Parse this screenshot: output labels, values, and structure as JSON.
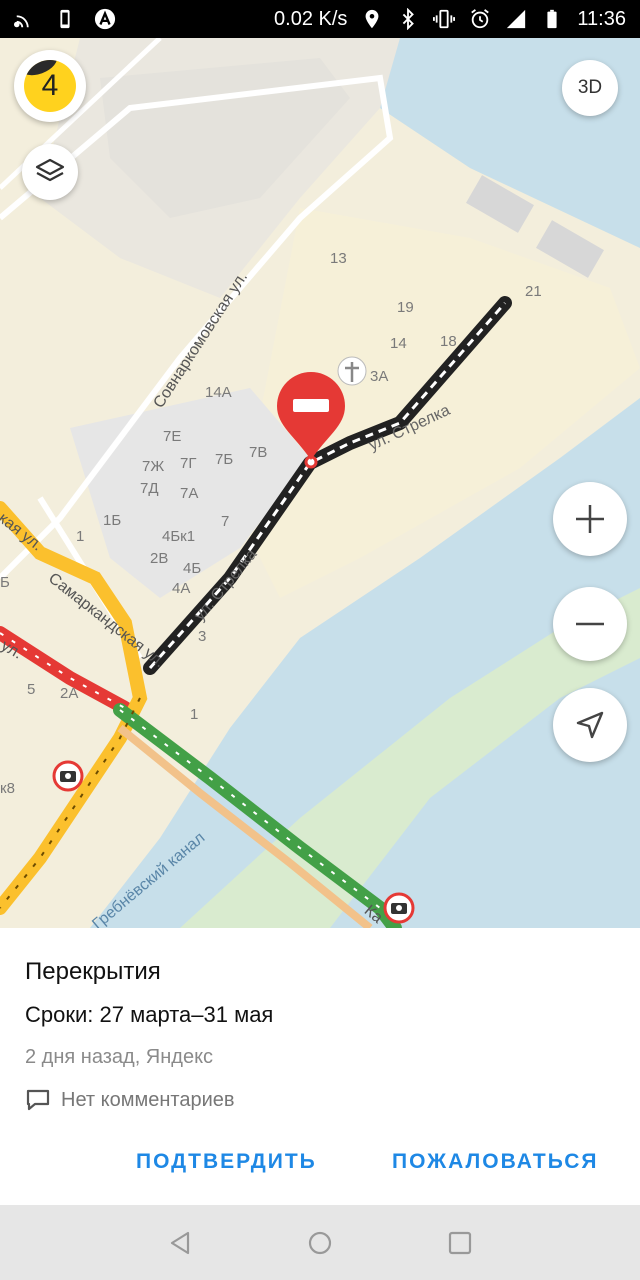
{
  "status_bar": {
    "network_speed": "0.02 K/s",
    "time": "11:36",
    "icons": [
      "signal-icon",
      "phone-icon",
      "a-badge-icon",
      "location-icon",
      "bluetooth-icon",
      "vibrate-icon",
      "alarm-icon",
      "mobile-data-icon",
      "battery-icon"
    ]
  },
  "map": {
    "traffic_level": "4",
    "btn_3d": "3D",
    "street_labels": {
      "sovnarkom": "Совнаркомовская ул.",
      "samarkand": "Самаркандская ул.",
      "strelka1": "ул. Стрелка",
      "strelka2": "ул. Стрелка",
      "grebnevsky": "Гребнёвский канал",
      "ul_left": "ул.",
      "kaya": "кая ул.",
      "ka": "Ка"
    },
    "building_numbers": [
      "13",
      "19",
      "21",
      "14",
      "18",
      "3А",
      "14А",
      "7Е",
      "7Ж",
      "7Г",
      "7Б",
      "7В",
      "7Д",
      "7А",
      "1Б",
      "1",
      "7",
      "4Бк1",
      "2В",
      "4Б",
      "4А",
      "3",
      "5",
      "2А",
      "1",
      "к8",
      "Б"
    ],
    "colors": {
      "water": "#c7dfea",
      "land": "#f3eedc",
      "block": "#e8e6e2",
      "green": "#d9ebcf",
      "traffic_red": "#e53935",
      "traffic_yellow": "#fbc02d",
      "traffic_green": "#43a047",
      "closure": "#e53935"
    }
  },
  "card": {
    "title": "Перекрытия",
    "dates": "Сроки: 27 марта–31 мая",
    "meta": "2 дня назад, Яндекс",
    "comments": "Нет комментариев",
    "confirm": "ПОДТВЕРДИТЬ",
    "report": "ПОЖАЛОВАТЬСЯ"
  }
}
